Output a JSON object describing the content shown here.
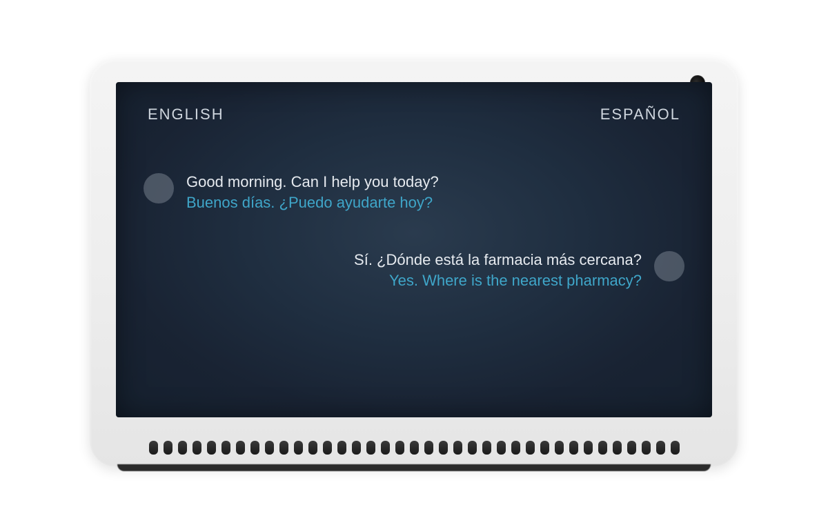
{
  "header": {
    "left_language": "ENGLISH",
    "right_language": "ESPAÑOL"
  },
  "messages": [
    {
      "side": "left",
      "primary": "Good morning. Can I help you today?",
      "secondary": "Buenos días. ¿Puedo ayudarte hoy?"
    },
    {
      "side": "right",
      "primary": "Sí. ¿Dónde está la farmacia más cercana?",
      "secondary": "Yes. Where is the nearest pharmacy?"
    }
  ],
  "colors": {
    "translation_accent": "#3fa6c9",
    "screen_bg": "#1f2e40",
    "bezel": "#eeeeee"
  }
}
